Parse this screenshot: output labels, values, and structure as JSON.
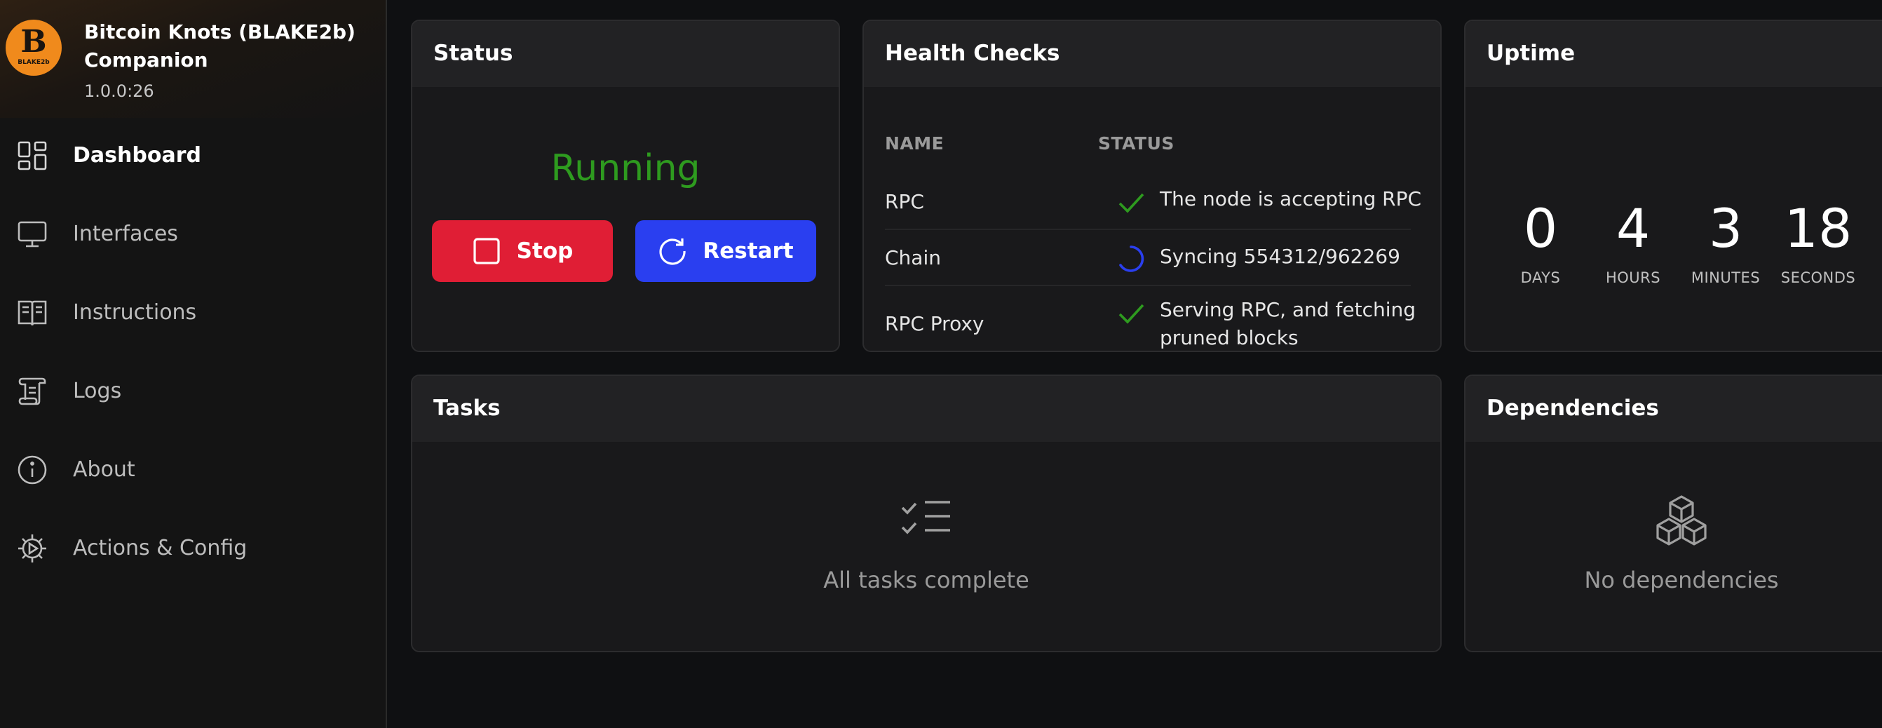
{
  "app": {
    "title": "Bitcoin Knots (BLAKE2b) Companion",
    "version": "1.0.0:26",
    "logo_letter": "B",
    "logo_text": "BLAKE2b",
    "accent_color": "#f08a1c"
  },
  "sidebar": {
    "items": [
      {
        "label": "Dashboard",
        "icon": "dashboard-grid-icon",
        "active": true
      },
      {
        "label": "Interfaces",
        "icon": "monitor-icon",
        "active": false
      },
      {
        "label": "Instructions",
        "icon": "book-icon",
        "active": false
      },
      {
        "label": "Logs",
        "icon": "scroll-icon",
        "active": false
      },
      {
        "label": "About",
        "icon": "info-icon",
        "active": false
      },
      {
        "label": "Actions & Config",
        "icon": "gear-play-icon",
        "active": false
      }
    ]
  },
  "status_card": {
    "title": "Status",
    "state": "Running",
    "state_color": "#2e9b1f",
    "stop_label": "Stop",
    "stop_color": "#e01e35",
    "restart_label": "Restart",
    "restart_color": "#2a3ff0"
  },
  "health_card": {
    "title": "Health Checks",
    "columns": [
      "NAME",
      "STATUS"
    ],
    "rows": [
      {
        "name": "RPC",
        "status": "success",
        "icon": "checkmark-icon",
        "message": "The node is accepting RPC"
      },
      {
        "name": "Chain",
        "status": "loading",
        "icon": "spinner-icon",
        "message": "Syncing 554312/962269"
      },
      {
        "name": "RPC Proxy",
        "status": "success",
        "icon": "checkmark-icon",
        "message": "Serving RPC, and fetching pruned blocks"
      }
    ],
    "success_color": "#2e9b1f",
    "loading_color": "#2a3ff0"
  },
  "uptime_card": {
    "title": "Uptime",
    "units": [
      {
        "value": "0",
        "label": "DAYS"
      },
      {
        "value": "4",
        "label": "HOURS"
      },
      {
        "value": "3",
        "label": "MINUTES"
      },
      {
        "value": "18",
        "label": "SECONDS"
      }
    ]
  },
  "tasks_card": {
    "title": "Tasks",
    "empty_icon": "checklist-icon",
    "empty_text": "All tasks complete"
  },
  "dependencies_card": {
    "title": "Dependencies",
    "empty_icon": "cubes-icon",
    "empty_text": "No dependencies"
  }
}
